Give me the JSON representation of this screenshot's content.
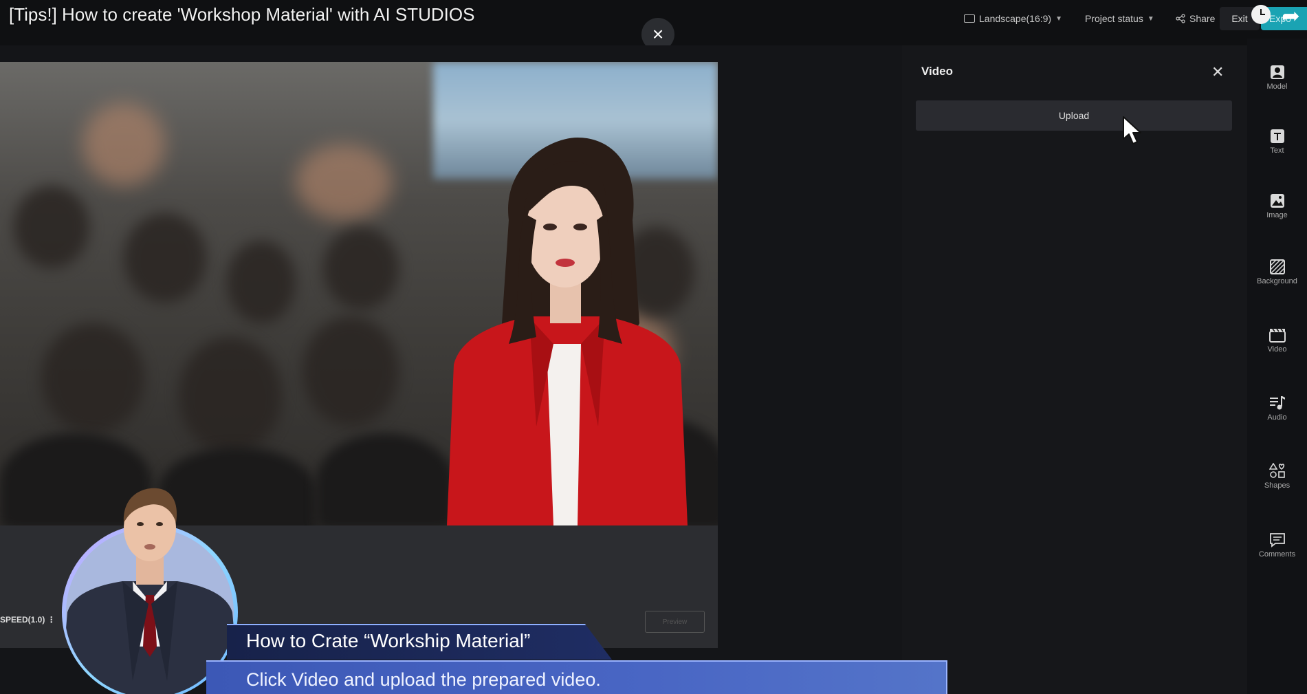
{
  "video_title": "[Tips!] How to create 'Workshop Material' with AI STUDIOS",
  "header": {
    "landscape_label": "Landscape(16:9)",
    "project_status_label": "Project status",
    "share_label": "Share",
    "exit_label": "Exit",
    "export_label": "Expo"
  },
  "editor": {
    "speed_label": "SPEED(1.0)",
    "preview_label": "Preview"
  },
  "panel": {
    "title": "Video",
    "upload_label": "Upload"
  },
  "rail": {
    "items": [
      {
        "label": "Model",
        "icon": "model-icon"
      },
      {
        "label": "Text",
        "icon": "text-icon"
      },
      {
        "label": "Image",
        "icon": "image-icon"
      },
      {
        "label": "Background",
        "icon": "background-icon"
      },
      {
        "label": "Video",
        "icon": "video-icon"
      },
      {
        "label": "Audio",
        "icon": "audio-icon"
      },
      {
        "label": "Shapes",
        "icon": "shapes-icon"
      },
      {
        "label": "Comments",
        "icon": "comments-icon"
      }
    ]
  },
  "caption": {
    "title": "How to Crate “Workship Material”",
    "subtitle": "Click Video and upload the prepared video."
  },
  "colors": {
    "accent": "#1aa3b3",
    "caption_dark": "#17224a",
    "caption_light": "#4966c4",
    "jacket_red": "#c8161b"
  }
}
